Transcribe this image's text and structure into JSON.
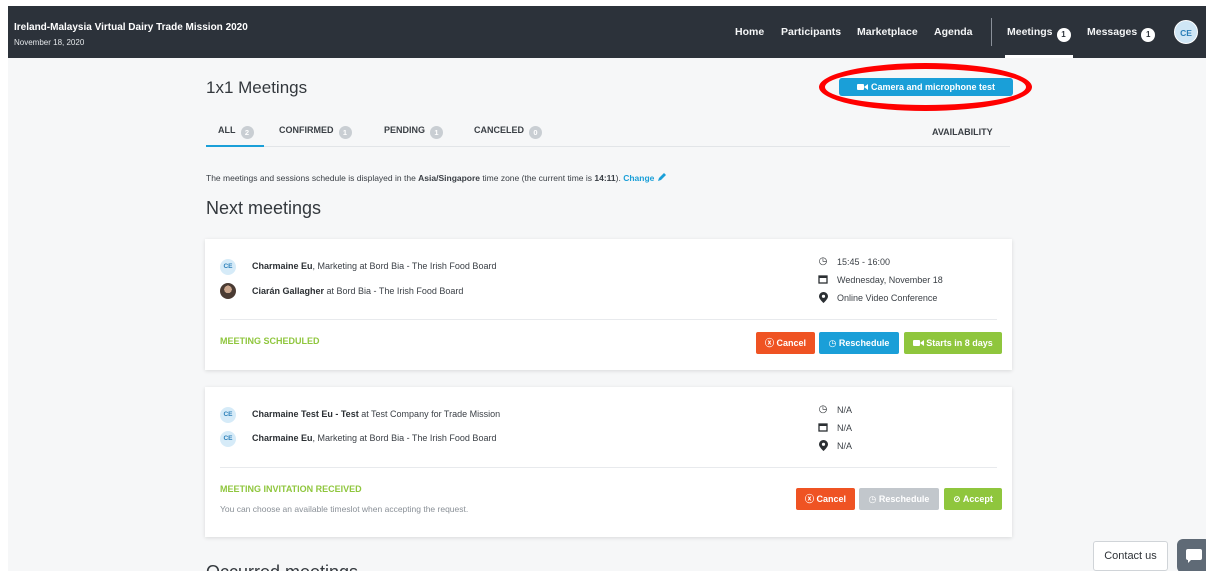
{
  "header": {
    "event_title": "Ireland-Malaysia Virtual Dairy Trade Mission 2020",
    "event_date": "November 18, 2020",
    "nav": {
      "home": "Home",
      "participants": "Participants",
      "marketplace": "Marketplace",
      "agenda": "Agenda",
      "meetings": "Meetings",
      "meetings_count": "1",
      "messages": "Messages",
      "messages_count": "1"
    },
    "avatar_initials": "CE"
  },
  "page": {
    "title": "1x1 Meetings",
    "camera_test_button": "Camera and microphone test",
    "tabs": [
      {
        "label": "ALL",
        "count": "2"
      },
      {
        "label": "CONFIRMED",
        "count": "1"
      },
      {
        "label": "PENDING",
        "count": "1"
      },
      {
        "label": "CANCELED",
        "count": "0"
      }
    ],
    "availability": "AVAILABILITY",
    "timezone": {
      "before": "The meetings and sessions schedule is displayed in the ",
      "zone": "Asia/Singapore",
      "middle": " time zone (the current time is ",
      "time": "14:11",
      "after": "). ",
      "change": "Change"
    },
    "next_meetings_title": "Next meetings",
    "occurred_meetings_title": "Occurred meetings"
  },
  "meetings": [
    {
      "participants": [
        {
          "initials": "CE",
          "name": "Charmaine Eu",
          "detail": ", Marketing at Bord Bia - The Irish Food Board"
        },
        {
          "initials": "",
          "name": "Ciarán Gallagher",
          "detail": " at Bord Bia - The Irish Food Board"
        }
      ],
      "time": "15:45 - 16:00",
      "date": "Wednesday, November 18",
      "location": "Online Video Conference",
      "status": "MEETING SCHEDULED",
      "buttons": {
        "cancel": "Cancel",
        "reschedule": "Reschedule",
        "start": "Starts in 8 days"
      }
    },
    {
      "participants": [
        {
          "initials": "CE",
          "name": "Charmaine Test Eu - Test",
          "detail": " at Test Company for Trade Mission"
        },
        {
          "initials": "CE",
          "name": "Charmaine Eu",
          "detail": ", Marketing at Bord Bia - The Irish Food Board"
        }
      ],
      "time": "N/A",
      "date": "N/A",
      "location": "N/A",
      "status": "MEETING INVITATION RECEIVED",
      "status_note": "You can choose an available timeslot when accepting the request.",
      "buttons": {
        "cancel": "Cancel",
        "reschedule": "Reschedule",
        "accept": "Accept"
      }
    }
  ],
  "contact_us": "Contact us",
  "colors": {
    "topbar": "#2c323a",
    "accent_blue": "#1a9fd8",
    "status_green": "#8fc63d",
    "cancel_red": "#ef5323",
    "highlight_red": "#ff0000"
  }
}
